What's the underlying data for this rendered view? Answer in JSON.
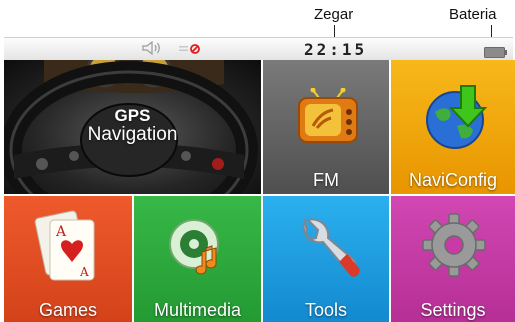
{
  "annotations": {
    "clock": "Zegar",
    "battery": "Bateria"
  },
  "status_bar": {
    "time": "22:15",
    "volume_icon": "speaker-icon",
    "mute_icon": "mute-indicator-icon",
    "battery_icon": "battery-icon"
  },
  "tiles": [
    {
      "id": "gps-navigation",
      "label_line1": "GPS",
      "label_line2": "Navigation",
      "icon": "steering-wheel-icon",
      "color": "#2a2a2a"
    },
    {
      "id": "fm",
      "label": "FM",
      "icon": "radio-tv-icon",
      "color": "#6d6d6d"
    },
    {
      "id": "naviconfig",
      "label": "NaviConfig",
      "icon": "globe-arrow-icon",
      "color": "#f3a400"
    },
    {
      "id": "games",
      "label": "Games",
      "icon": "playing-cards-icon",
      "color": "#e84e24"
    },
    {
      "id": "multimedia",
      "label": "Multimedia",
      "icon": "music-disc-icon",
      "color": "#2faa3c"
    },
    {
      "id": "tools",
      "label": "Tools",
      "icon": "wrench-icon",
      "color": "#1e9fe0"
    },
    {
      "id": "settings",
      "label": "Settings",
      "icon": "gear-icon",
      "color": "#c93aa6"
    }
  ]
}
